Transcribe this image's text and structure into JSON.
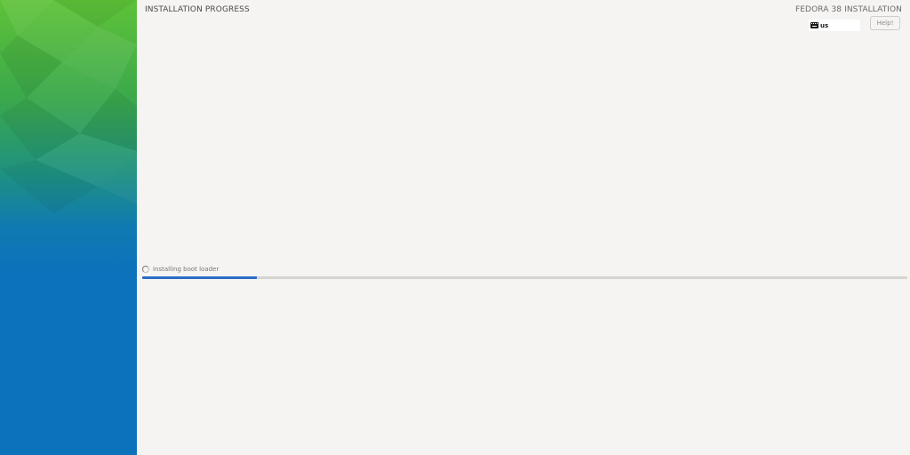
{
  "header": {
    "page_title": "INSTALLATION PROGRESS",
    "product_title": "FEDORA 38 INSTALLATION",
    "keyboard_layout": "us",
    "help_label": "Help!"
  },
  "progress": {
    "status_text": "Installing boot loader",
    "fraction": 0.15
  },
  "colors": {
    "accent": "#2a6ec4",
    "sidebar_top": "#5ec237",
    "sidebar_bottom": "#0c72bb"
  },
  "icons": {
    "keyboard": "keyboard-icon",
    "spinner": "spinner-icon"
  }
}
